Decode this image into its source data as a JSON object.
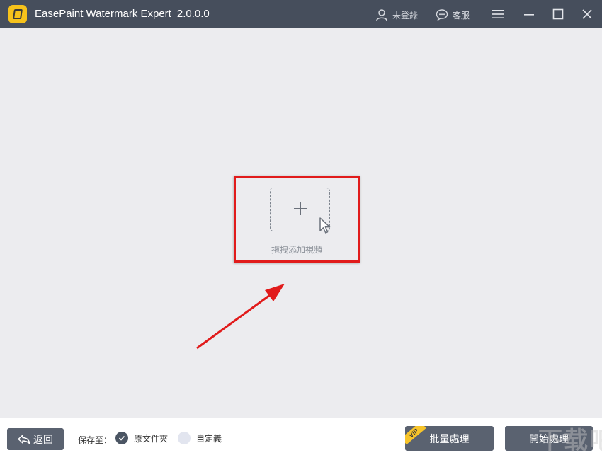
{
  "app": {
    "title": "EasePaint Watermark Expert",
    "version": "2.0.0.0",
    "logo_icon": "app-logo-icon"
  },
  "titlebar": {
    "user_label": "未登錄",
    "service_label": "客服",
    "icons": [
      "user-icon",
      "chat-icon",
      "menu-icon",
      "minimize-icon",
      "maximize-icon",
      "close-icon"
    ]
  },
  "main": {
    "drop_label": "拖拽添加視頻",
    "annotation_color": "#e11b1b"
  },
  "footer": {
    "back_label": "返回",
    "save_to_label": "保存至：",
    "options": [
      {
        "label": "原文件夾",
        "checked": true
      },
      {
        "label": "自定義",
        "checked": false
      }
    ],
    "vip_label": "VIP",
    "batch_label": "批量處理",
    "start_label": "開始處理"
  },
  "colors": {
    "titlebar": "#464e5c",
    "main_bg": "#ececef",
    "button": "#5a6270",
    "logo": "#f6c21b"
  }
}
